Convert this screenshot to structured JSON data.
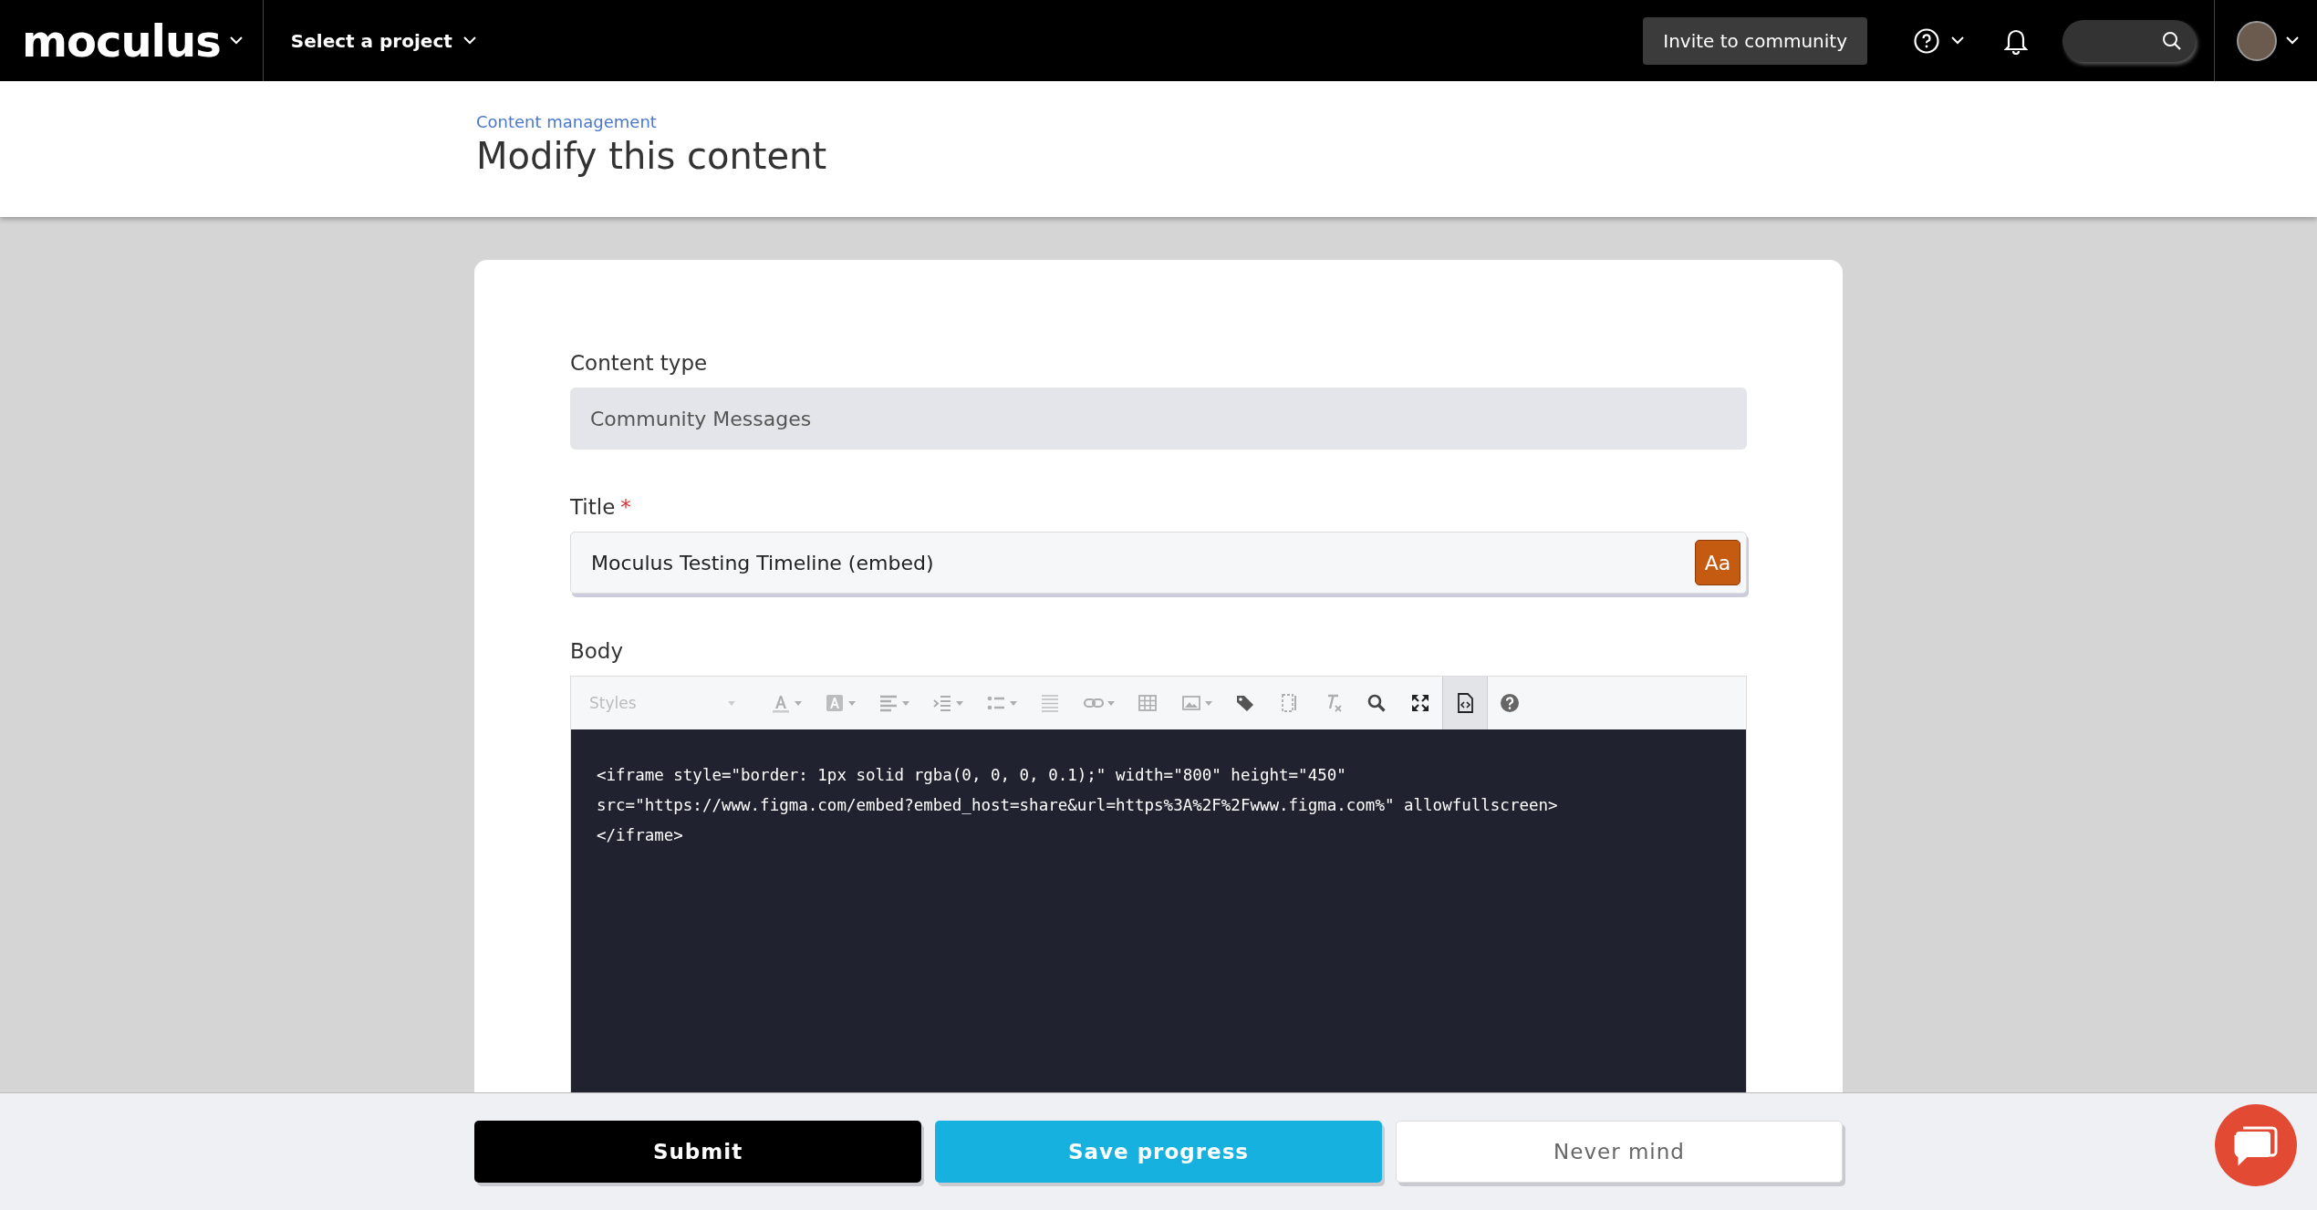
{
  "topbar": {
    "logo": "moculus",
    "project_select": "Select a project",
    "invite_button": "Invite to community"
  },
  "header": {
    "breadcrumb": "Content management",
    "title": "Modify this content"
  },
  "form": {
    "content_type": {
      "label": "Content type",
      "value": "Community Messages",
      "disabled": true
    },
    "title": {
      "label": "Title",
      "required_mark": "*",
      "value": "Moculus Testing Timeline (embed)",
      "tool_button": "Aa"
    },
    "body": {
      "label": "Body",
      "styles_placeholder": "Styles",
      "toolbar": [
        {
          "dropdown": true,
          "disabled": true,
          "selected": false
        },
        {
          "dropdown": true,
          "disabled": true,
          "selected": false
        },
        {
          "dropdown": true,
          "disabled": true,
          "selected": false
        },
        {
          "dropdown": true,
          "disabled": true,
          "selected": false
        },
        {
          "dropdown": true,
          "disabled": true,
          "selected": false
        },
        {
          "dropdown": false,
          "disabled": true,
          "selected": false
        },
        {
          "dropdown": true,
          "disabled": true,
          "selected": false
        },
        {
          "dropdown": false,
          "disabled": true,
          "selected": false
        },
        {
          "dropdown": true,
          "disabled": true,
          "selected": false
        },
        {
          "dropdown": false,
          "disabled": false,
          "selected": false
        },
        {
          "dropdown": false,
          "disabled": true,
          "selected": false
        },
        {
          "dropdown": false,
          "disabled": true,
          "selected": false
        },
        {
          "dropdown": false,
          "disabled": false,
          "selected": false
        },
        {
          "dropdown": false,
          "disabled": false,
          "selected": false
        },
        {
          "dropdown": false,
          "disabled": false,
          "selected": true
        },
        {
          "dropdown": false,
          "disabled": false,
          "selected": false
        }
      ],
      "code_lines": [
        "<iframe style=\"border: 1px solid rgba(0, 0, 0, 0.1);\" width=\"800\" height=\"450\"",
        "src=\"https://www.figma.com/embed?embed_host=share&url=https%3A%2F%2Fwww.figma.com%\" allowfullscreen>",
        "</iframe>"
      ]
    }
  },
  "actions": [
    {
      "label": "Submit",
      "kind": "primary"
    },
    {
      "label": "Save progress",
      "kind": "secondary"
    },
    {
      "label": "Never mind",
      "kind": "cancel"
    }
  ]
}
